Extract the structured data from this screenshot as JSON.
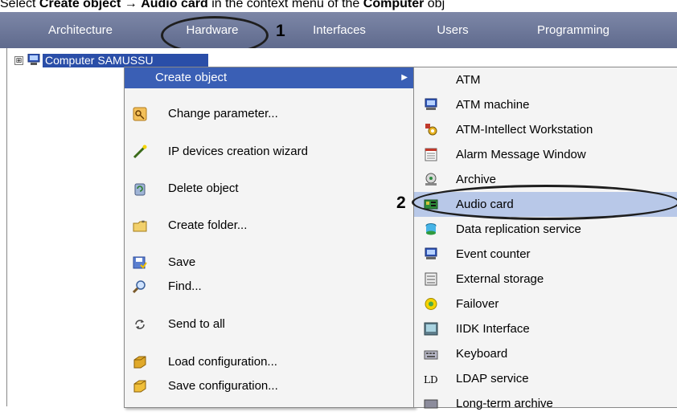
{
  "caption": {
    "prefix": "Select ",
    "bold1": "Create object",
    "sep": " → ",
    "bold2": "Audio card",
    "middle": " in the context menu of the ",
    "bold3": "Computer",
    "suffix": " obj"
  },
  "tabs": [
    {
      "label": "Architecture"
    },
    {
      "label": "Hardware"
    },
    {
      "label": "Interfaces"
    },
    {
      "label": "Users"
    },
    {
      "label": "Programming"
    }
  ],
  "tree": {
    "expander": "⊞",
    "root_label": "Computer SAMUSSU"
  },
  "context_menu": {
    "items": [
      {
        "label": "Create object",
        "icon": "none",
        "submenu_arrow": "▶"
      },
      {
        "label": "Change parameter...",
        "icon": "key-icon"
      },
      {
        "label": "IP devices creation wizard",
        "icon": "wand-icon"
      },
      {
        "label": "Delete object",
        "icon": "recycle-icon"
      },
      {
        "label": "Create folder...",
        "icon": "folder-icon"
      },
      {
        "label": "Save",
        "icon": "save-icon"
      },
      {
        "label": "Find...",
        "icon": "magnifier-icon"
      },
      {
        "label": "Send to all",
        "icon": "sync-icon"
      },
      {
        "label": "Load configuration...",
        "icon": "load-icon"
      },
      {
        "label": "Save configuration...",
        "icon": "save-config-icon"
      }
    ]
  },
  "submenu": {
    "items": [
      {
        "label": "ATM"
      },
      {
        "label": "ATM machine"
      },
      {
        "label": "ATM-Intellect Workstation"
      },
      {
        "label": "Alarm Message Window"
      },
      {
        "label": "Archive"
      },
      {
        "label": "Audio card"
      },
      {
        "label": "Data replication service"
      },
      {
        "label": "Event counter"
      },
      {
        "label": "External storage"
      },
      {
        "label": "Failover"
      },
      {
        "label": "IIDK Interface"
      },
      {
        "label": "Keyboard"
      },
      {
        "label": "LDAP service"
      },
      {
        "label": "Long-term archive"
      }
    ]
  },
  "annotations": {
    "step1": "1",
    "step2": "2"
  },
  "colors": {
    "tabbar": "#6b7596",
    "selection": "#3a5fb5",
    "highlight": "#b8c8e8"
  }
}
